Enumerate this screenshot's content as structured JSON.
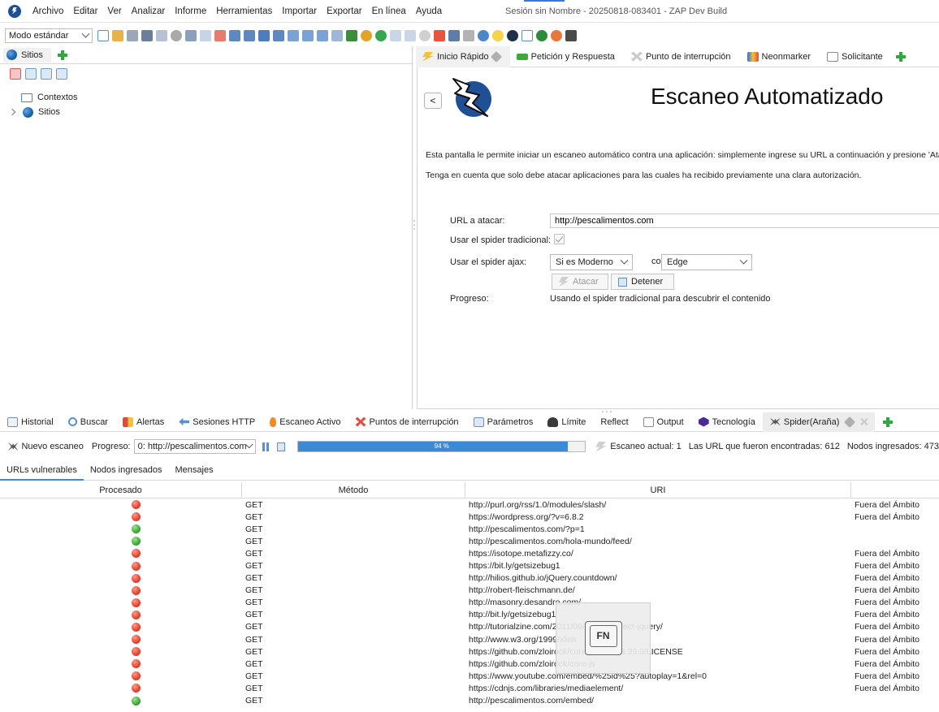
{
  "menubar": {
    "items": [
      "Archivo",
      "Editar",
      "Ver",
      "Analizar",
      "Informe",
      "Herramientas",
      "Importar",
      "Exportar",
      "En línea",
      "Ayuda"
    ],
    "window_title": "Sesión sin Nombre - 20250818-083401 - ZAP Dev Build"
  },
  "toolbar": {
    "mode": "Modo estándar"
  },
  "left_panel": {
    "tab_label": "Sitios",
    "tree": {
      "contexts_label": "Contextos",
      "sites_label": "Sitios"
    }
  },
  "right_panel": {
    "tabs": [
      "Inicio Rápido",
      "Petición y Respuesta",
      "Punto de interrupción",
      "Neonmarker",
      "Solicitante"
    ],
    "back_label": "<",
    "title": "Escaneo Automatizado",
    "desc1": "Esta pantalla le permite iniciar un escaneo automático contra una aplicación: simplemente ingrese su URL a continuación y presione 'Atacar'",
    "desc2": "Tenga en cuenta que solo debe atacar aplicaciones para las cuales ha recibido previamente una clara autorización.",
    "url_label": "URL a atacar:",
    "url_value": "http://pescalimentos.com",
    "trad_spider_label": "Usar el spider tradicional:",
    "ajax_spider_label": "Usar el spider ajax:",
    "ajax_option": "Si es Moderno",
    "con_label": "con",
    "browser_option": "Edge",
    "attack_label": "Atacar",
    "stop_label": "Detener",
    "progress_label": "Progreso:",
    "progress_value": "Usando el spider tradicional para descubrir el contenido"
  },
  "bottom_tabs": [
    "Historial",
    "Buscar",
    "Alertas",
    "Sesiones HTTP",
    "Escaneo Activo",
    "Puntos de interrupción",
    "Parámetros",
    "Límite",
    "Reflect",
    "Output",
    "Tecnología",
    "Spider(Araña)"
  ],
  "spider_bar": {
    "new_scan": "Nuevo escaneo",
    "progress_label": "Progreso:",
    "progress_select": "0: http://pescalimentos.com",
    "progress_percent": "94 %",
    "progress_fraction": 0.94,
    "current_scan": "Escaneo actual: 1",
    "urls_found": "Las URL que fueron encontradas: 612",
    "nodes_added": "Nodos ingresados: 473"
  },
  "subtabs": [
    "URLs vulnerables",
    "Nodos ingresados",
    "Mensajes"
  ],
  "table": {
    "headers": [
      "Procesado",
      "Método",
      "URI",
      ""
    ],
    "rows": [
      {
        "status": "red",
        "method": "GET",
        "uri": "http://purl.org/rss/1.0/modules/slash/",
        "flag": "Fuera del Ámbito"
      },
      {
        "status": "red",
        "method": "GET",
        "uri": "https://wordpress.org/?v=6.8.2",
        "flag": "Fuera del Ámbito"
      },
      {
        "status": "green",
        "method": "GET",
        "uri": "http://pescalimentos.com/?p=1",
        "flag": ""
      },
      {
        "status": "green",
        "method": "GET",
        "uri": "http://pescalimentos.com/hola-mundo/feed/",
        "flag": ""
      },
      {
        "status": "red",
        "method": "GET",
        "uri": "https://isotope.metafizzy.co/",
        "flag": "Fuera del Ámbito"
      },
      {
        "status": "red",
        "method": "GET",
        "uri": "https://bit.ly/getsizebug1",
        "flag": "Fuera del Ámbito"
      },
      {
        "status": "red",
        "method": "GET",
        "uri": "http://hilios.github.io/jQuery.countdown/",
        "flag": "Fuera del Ámbito"
      },
      {
        "status": "red",
        "method": "GET",
        "uri": "http://robert-fleischmann.de/",
        "flag": "Fuera del Ámbito"
      },
      {
        "status": "red",
        "method": "GET",
        "uri": "http://masonry.desandro.com/",
        "flag": "Fuera del Ámbito"
      },
      {
        "status": "red",
        "method": "GET",
        "uri": "http://bit.ly/getsizebug1",
        "flag": "Fuera del Ámbito"
      },
      {
        "status": "red",
        "method": "GET",
        "uri": "http://tutorialzine.com/2011/09/shutter-effect-jquery/",
        "flag": "Fuera del Ámbito"
      },
      {
        "status": "red",
        "method": "GET",
        "uri": "http://www.w3.org/1999/xlink",
        "flag": "Fuera del Ámbito"
      },
      {
        "status": "red",
        "method": "GET",
        "uri": "https://github.com/zloirock/core-js/blob/v3.39.0/LICENSE",
        "flag": "Fuera del Ámbito"
      },
      {
        "status": "red",
        "method": "GET",
        "uri": "https://github.com/zloirock/core-js",
        "flag": "Fuera del Ámbito"
      },
      {
        "status": "red",
        "method": "GET",
        "uri": "https://www.youtube.com/embed/%25id%25?autoplay=1&rel=0",
        "flag": "Fuera del Ámbito"
      },
      {
        "status": "red",
        "method": "GET",
        "uri": "https://cdnjs.com/libraries/mediaelement/",
        "flag": "Fuera del Ámbito"
      },
      {
        "status": "green",
        "method": "GET",
        "uri": "http://pescalimentos.com/embed/",
        "flag": ""
      }
    ]
  },
  "overlay": {
    "key_label": "FN"
  }
}
